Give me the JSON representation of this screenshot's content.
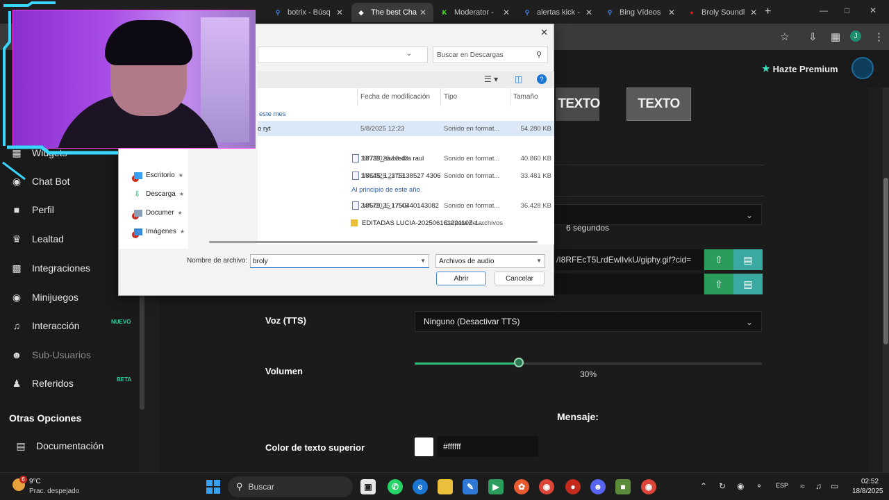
{
  "browser": {
    "tabs": [
      {
        "label": "botrix - Búsq",
        "color": "#4a8af4",
        "icon": "search-icon"
      },
      {
        "label": "The best Cha",
        "color": "#ffffff",
        "icon": "diamond-icon",
        "active": true
      },
      {
        "label": "Moderator - ",
        "color": "#53fc18",
        "icon": "kick-icon"
      },
      {
        "label": "alertas kick -",
        "color": "#4a8af4",
        "icon": "search-icon"
      },
      {
        "label": "Bing Vídeos",
        "color": "#4a8af4",
        "icon": "search-icon"
      },
      {
        "label": "Broly Soundl",
        "color": "#d32020",
        "icon": "soundboard-icon"
      }
    ],
    "profile_initial": "J"
  },
  "header": {
    "premium_label": "Hazte Premium",
    "premium_color": "#3ee0c0"
  },
  "sidebar": {
    "items": [
      {
        "label": "Widgets",
        "icon": "widgets-icon"
      },
      {
        "label": "Chat Bot",
        "icon": "robot-icon"
      },
      {
        "label": "Perfil",
        "icon": "user-icon"
      },
      {
        "label": "Lealtad",
        "icon": "trophy-icon"
      },
      {
        "label": "Integraciones",
        "icon": "integrations-icon"
      },
      {
        "label": "Minijuegos",
        "icon": "gamepad-icon"
      },
      {
        "label": "Interacción",
        "icon": "music-icon",
        "badge": "NUEVO"
      },
      {
        "label": "Sub-Usuarios",
        "icon": "users-icon",
        "disabled": true
      },
      {
        "label": "Referidos",
        "icon": "referral-icon",
        "badge": "BETA"
      }
    ],
    "section_title": "Otras Opciones",
    "docs_label": "Documentación"
  },
  "main": {
    "thumb_buttons": [
      "TEXTO",
      "TEXTO"
    ],
    "duration_value": "6 segundos",
    "gif_url": "/I8RFEcT5LrdEwlIvkU/giphy.gif?cid=",
    "voice": {
      "label": "Voz (TTS)",
      "value": "Ninguno (Desactivar TTS)"
    },
    "volume": {
      "label": "Volumen",
      "value_text": "30%",
      "level": 0.3
    },
    "message_heading": "Mensaje:",
    "top_text_color": {
      "label": "Color de texto superior",
      "value": "#ffffff"
    }
  },
  "dialog": {
    "search_placeholder": "Buscar en Descargas",
    "columns": [
      "Fecha de modificación",
      "Tipo",
      "Tamaño"
    ],
    "groups": [
      "este mes",
      "Al principio de este año"
    ],
    "files": [
      {
        "name": "o ryt",
        "date": "5/8/2025 12:23",
        "type": "Sonido en format...",
        "size": "54.280 KB",
        "selected": true,
        "kind": "audio"
      },
      {
        "name": "18739_saavedra raul",
        "date": "19/7/2025 19:43",
        "type": "Sonido en format...",
        "size": "40.860 KB",
        "kind": "audio"
      },
      {
        "name": "18645_1_175138527 4306",
        "date": "1/7/2025 23:13",
        "type": "Sonido en format...",
        "size": "33.481 KB",
        "kind": "audio"
      },
      {
        "name": "18579_1_1750440143082",
        "date": "24/6/2025 17:45",
        "type": "Sonido en format...",
        "size": "36.428 KB",
        "kind": "audio"
      },
      {
        "name": "EDITADAS LUCIA-20250616122110Z-1-...",
        "date": "16/6/2025 19:22",
        "type": "Carpeta de archivos",
        "size": "",
        "kind": "folder"
      }
    ],
    "nav": [
      {
        "label": "Escritorio",
        "icon": "desktop-icon"
      },
      {
        "label": "Descarga",
        "icon": "download-icon"
      },
      {
        "label": "Documer",
        "icon": "documents-icon"
      },
      {
        "label": "Imágenes",
        "icon": "images-icon"
      }
    ],
    "filename_label": "Nombre de archivo:",
    "filename_value": "broly",
    "filter_value": "Archivos de audio",
    "open_label": "Abrir",
    "cancel_label": "Cancelar"
  },
  "taskbar": {
    "weather_temp": "9°C",
    "weather_desc": "Prac. despejado",
    "weather_badge": "6",
    "search_label": "Buscar",
    "lang": "ESP",
    "time": "02:52",
    "date": "18/8/2025",
    "apps": [
      "browser-icon",
      "taskview-icon",
      "whatsapp-icon",
      "edge-icon",
      "files-icon",
      "notes-icon",
      "meet-icon",
      "photos-icon",
      "chrome-icon",
      "app-icon",
      "discord-icon",
      "minecraft-icon",
      "chrome-active-icon"
    ]
  }
}
